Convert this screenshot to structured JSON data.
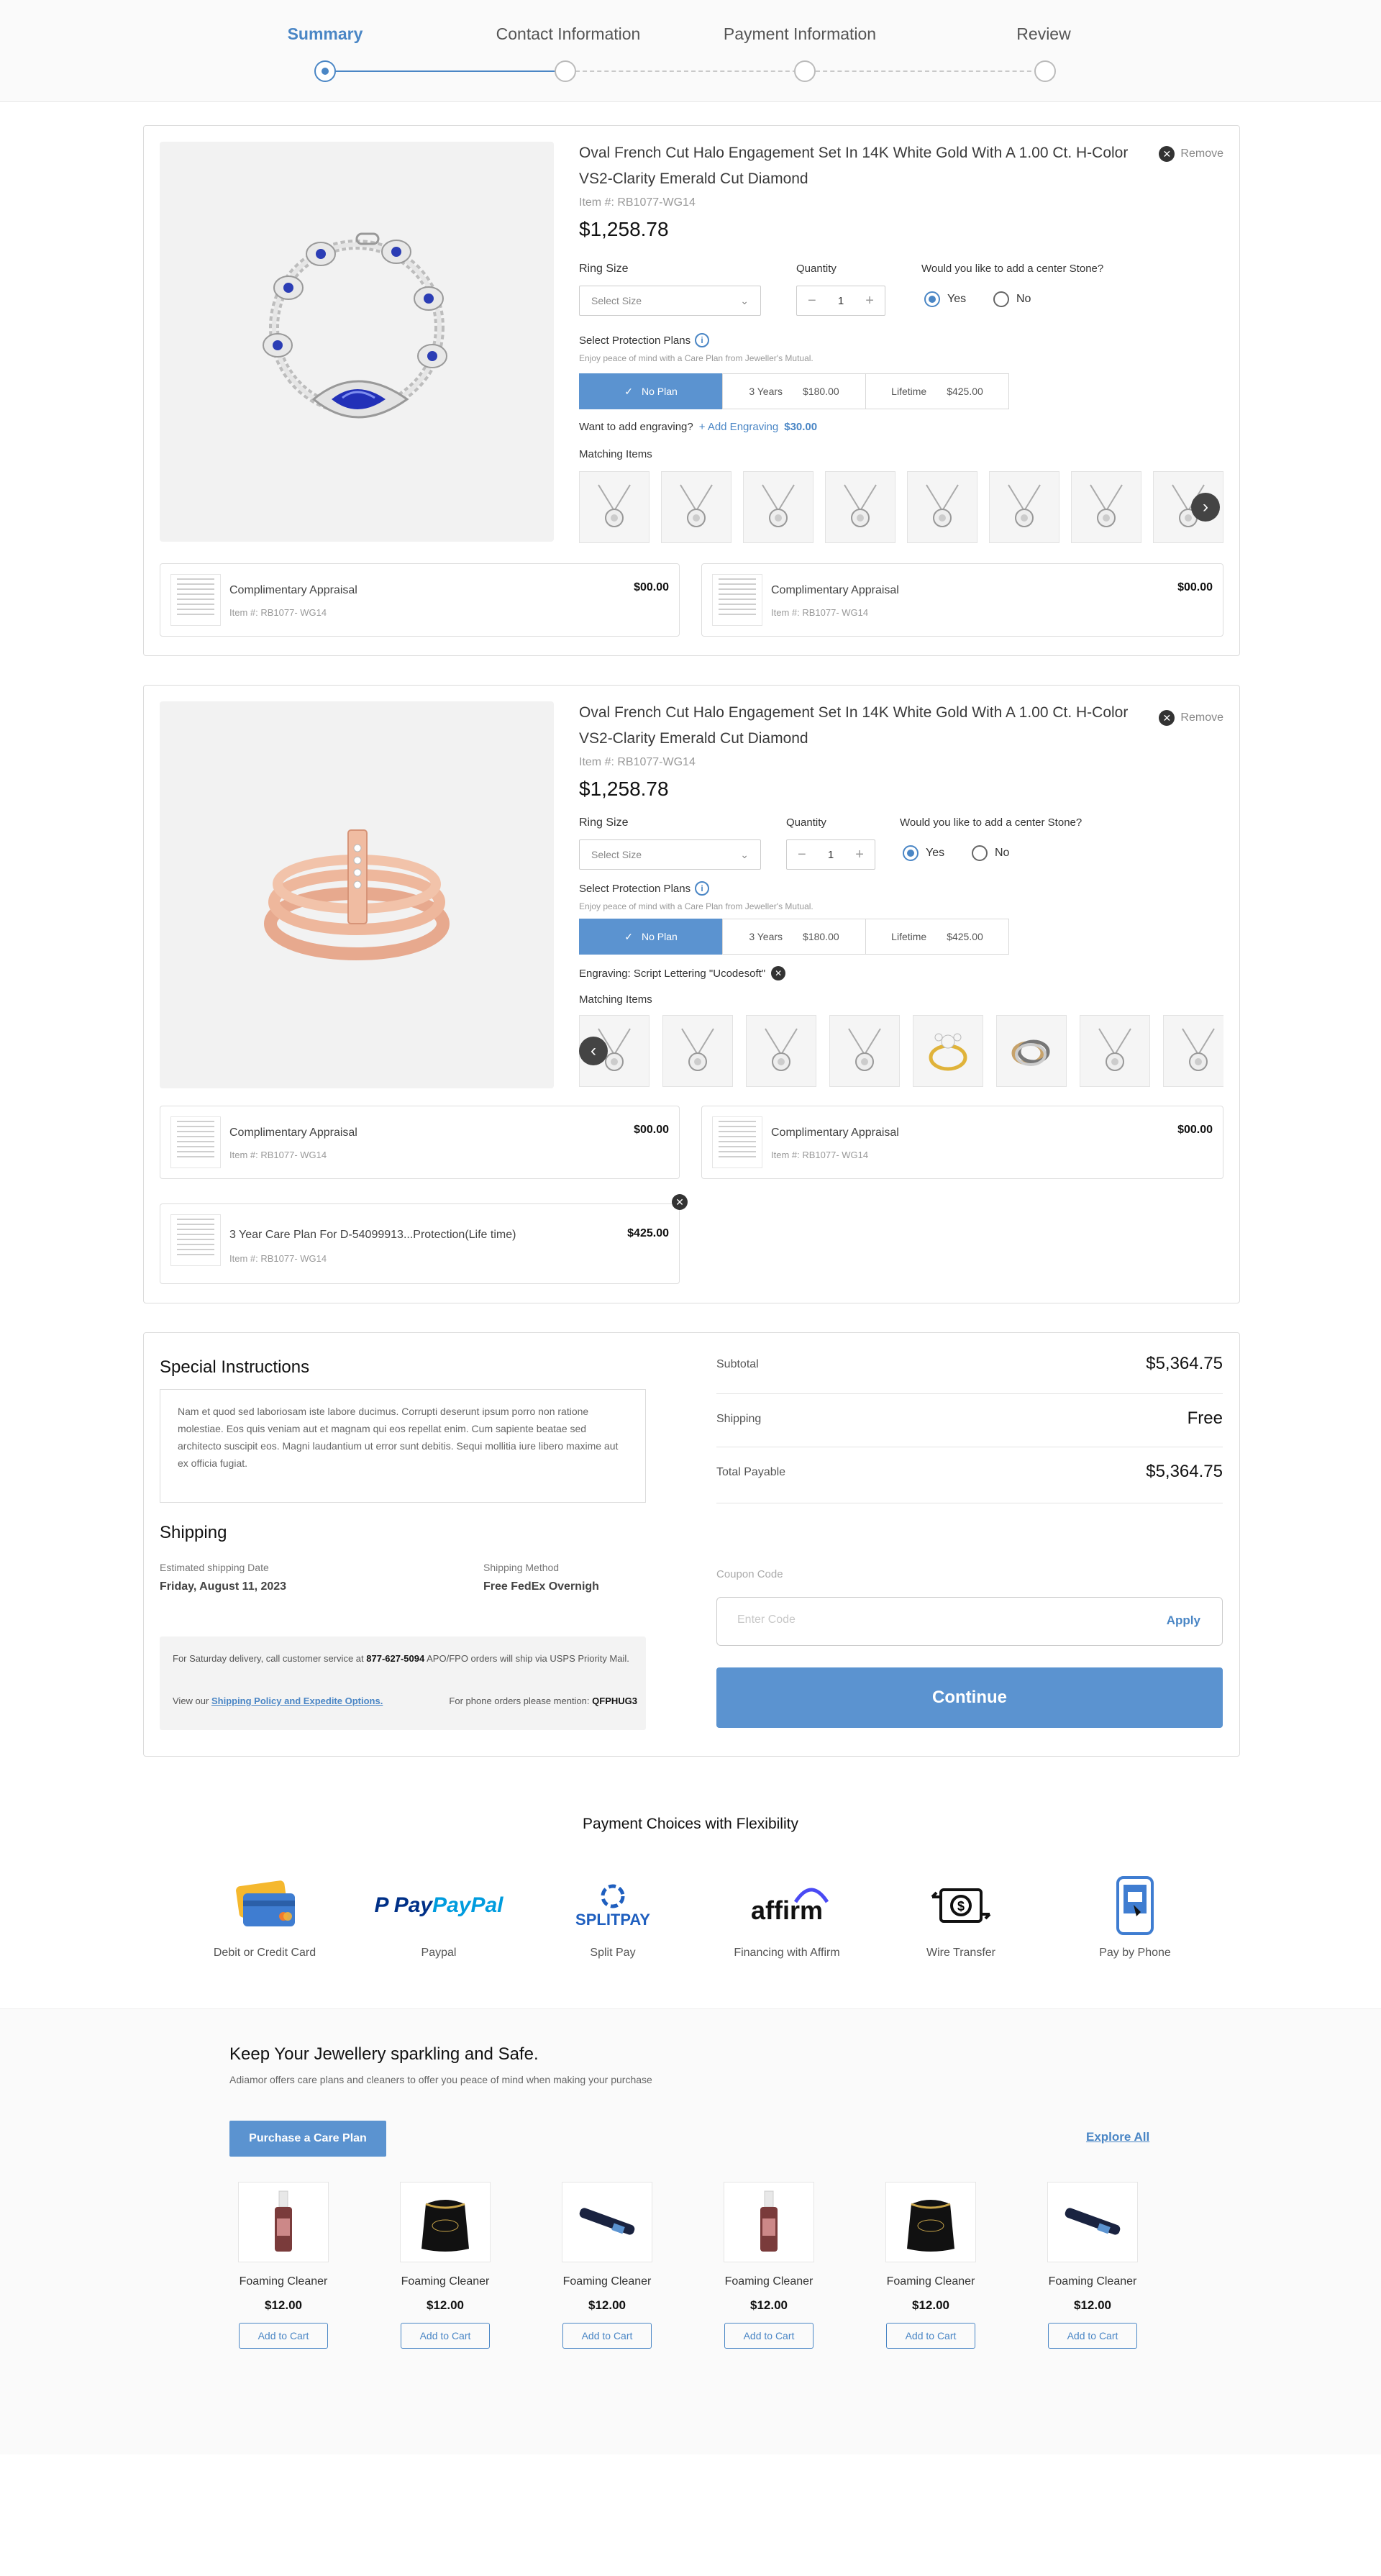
{
  "steps": [
    {
      "label": "Summary"
    },
    {
      "label": "Contact Information"
    },
    {
      "label": "Payment Information"
    },
    {
      "label": "Review"
    }
  ],
  "products": [
    {
      "title": "Oval French Cut Halo Engagement Set In 14K White Gold With A 1.00 Ct. H-Color VS2-Clarity Emerald Cut Diamond",
      "item_no": "Item #: RB1077-WG14",
      "price": "$1,258.78",
      "remove": "Remove",
      "ring_size_label": "Ring Size",
      "ring_size_placeholder": "Select Size",
      "quantity_label": "Quantity",
      "quantity": "1",
      "center_stone_question": "Would you like to add a center Stone?",
      "yes": "Yes",
      "no": "No",
      "protection_label": "Select Protection Plans",
      "protection_sub": "Enjoy peace of mind with a Care Plan from Jeweller's Mutual.",
      "plans": [
        {
          "label": "No Plan",
          "price": ""
        },
        {
          "label": "3 Years",
          "price": "$180.00"
        },
        {
          "label": "Lifetime",
          "price": "$425.00"
        }
      ],
      "engraving_q": "Want to add engraving?",
      "add_engraving": "Add Engraving",
      "engraving_price": "$30.00",
      "matching_label": "Matching Items",
      "appraisals": [
        {
          "name": "Complimentary Appraisal",
          "item": "Item #: RB1077- WG14",
          "price": "$00.00"
        },
        {
          "name": "Complimentary Appraisal",
          "item": "Item #: RB1077- WG14",
          "price": "$00.00"
        }
      ]
    },
    {
      "title": "Oval French Cut Halo Engagement Set In 14K White Gold With A 1.00 Ct. H-Color VS2-Clarity Emerald Cut Diamond",
      "item_no": "Item #: RB1077-WG14",
      "price": "$1,258.78",
      "remove": "Remove",
      "ring_size_label": "Ring Size",
      "ring_size_placeholder": "Select Size",
      "quantity_label": "Quantity",
      "quantity": "1",
      "center_stone_question": "Would you like to add a center Stone?",
      "yes": "Yes",
      "no": "No",
      "protection_label": "Select Protection Plans",
      "protection_sub": "Enjoy peace of mind with a Care Plan from Jeweller's Mutual.",
      "plans": [
        {
          "label": "No Plan",
          "price": ""
        },
        {
          "label": "3 Years",
          "price": "$180.00"
        },
        {
          "label": "Lifetime",
          "price": "$425.00"
        }
      ],
      "engraving_text": "Engraving: Script Lettering \"Ucodesoft\"",
      "matching_label": "Matching Items",
      "appraisals": [
        {
          "name": "Complimentary Appraisal",
          "item": "Item #: RB1077- WG14",
          "price": "$00.00"
        },
        {
          "name": "Complimentary Appraisal",
          "item": "Item #: RB1077- WG14",
          "price": "$00.00"
        },
        {
          "name": "3 Year Care Plan For D-54099913...Protection(Life time)",
          "item": "Item #: RB1077- WG14",
          "price": "$425.00"
        }
      ]
    }
  ],
  "special": {
    "title": "Special Instructions",
    "note": "Nam et quod sed laboriosam iste labore ducimus. Corrupti deserunt ipsum porro non ratione molestiae. Eos quis veniam aut et magnam qui eos repellat enim. Cum sapiente beatae sed architecto suscipit eos. Magni laudantium ut error sunt debitis. Sequi mollitia iure libero maxime aut ex officia fugiat."
  },
  "shipping": {
    "title": "Shipping",
    "date_label": "Estimated shipping Date",
    "date": "Friday, August 11, 2023",
    "method_label": "Shipping Method",
    "method": "Free FedEx Overnigh",
    "info_pre": "For Saturday delivery, call customer service at",
    "phone": "877-627-5094",
    "info_post": "APO/FPO orders will ship via USPS Priority Mail.",
    "view_our": "View our",
    "policy_link": "Shipping Policy and Expedite Options.",
    "phone_orders": "For phone orders please mention:",
    "code": "QFPHUG3"
  },
  "totals": {
    "subtotal_label": "Subtotal",
    "subtotal": "$5,364.75",
    "shipping_label": "Shipping",
    "shipping": "Free",
    "total_label": "Total Payable",
    "total": "$5,364.75",
    "coupon_label": "Coupon Code",
    "coupon_placeholder": "Enter Code",
    "apply": "Apply",
    "continue": "Continue"
  },
  "payment": {
    "title": "Payment Choices with Flexibility",
    "options": [
      {
        "label": "Debit or Credit Card",
        "icon": "credit-card-icon"
      },
      {
        "label": "Paypal",
        "logo": "PayPal"
      },
      {
        "label": "Split Pay",
        "logo": "SPLITPAY"
      },
      {
        "label": "Financing with Affirm",
        "logo": "affirm"
      },
      {
        "label": "Wire Transfer",
        "icon": "wire-transfer-icon"
      },
      {
        "label": "Pay by Phone",
        "icon": "phone-icon"
      }
    ]
  },
  "care": {
    "title": "Keep Your Jewellery sparkling and Safe.",
    "subtitle": "Adiamor offers care plans and cleaners to offer you peace of mind when making your purchase",
    "purchase_btn": "Purchase a Care Plan",
    "explore": "Explore All",
    "products": [
      {
        "name": "Foaming Cleaner",
        "price": "$12.00",
        "btn": "Add to Cart",
        "kind": "bottle"
      },
      {
        "name": "Foaming Cleaner",
        "price": "$12.00",
        "btn": "Add to Cart",
        "kind": "pouch"
      },
      {
        "name": "Foaming Cleaner",
        "price": "$12.00",
        "btn": "Add to Cart",
        "kind": "pen"
      },
      {
        "name": "Foaming Cleaner",
        "price": "$12.00",
        "btn": "Add to Cart",
        "kind": "bottle"
      },
      {
        "name": "Foaming Cleaner",
        "price": "$12.00",
        "btn": "Add to Cart",
        "kind": "pouch"
      },
      {
        "name": "Foaming Cleaner",
        "price": "$12.00",
        "btn": "Add to Cart",
        "kind": "pen"
      }
    ]
  },
  "colors": {
    "accent": "#4a86c5",
    "button": "#5b93d0"
  }
}
